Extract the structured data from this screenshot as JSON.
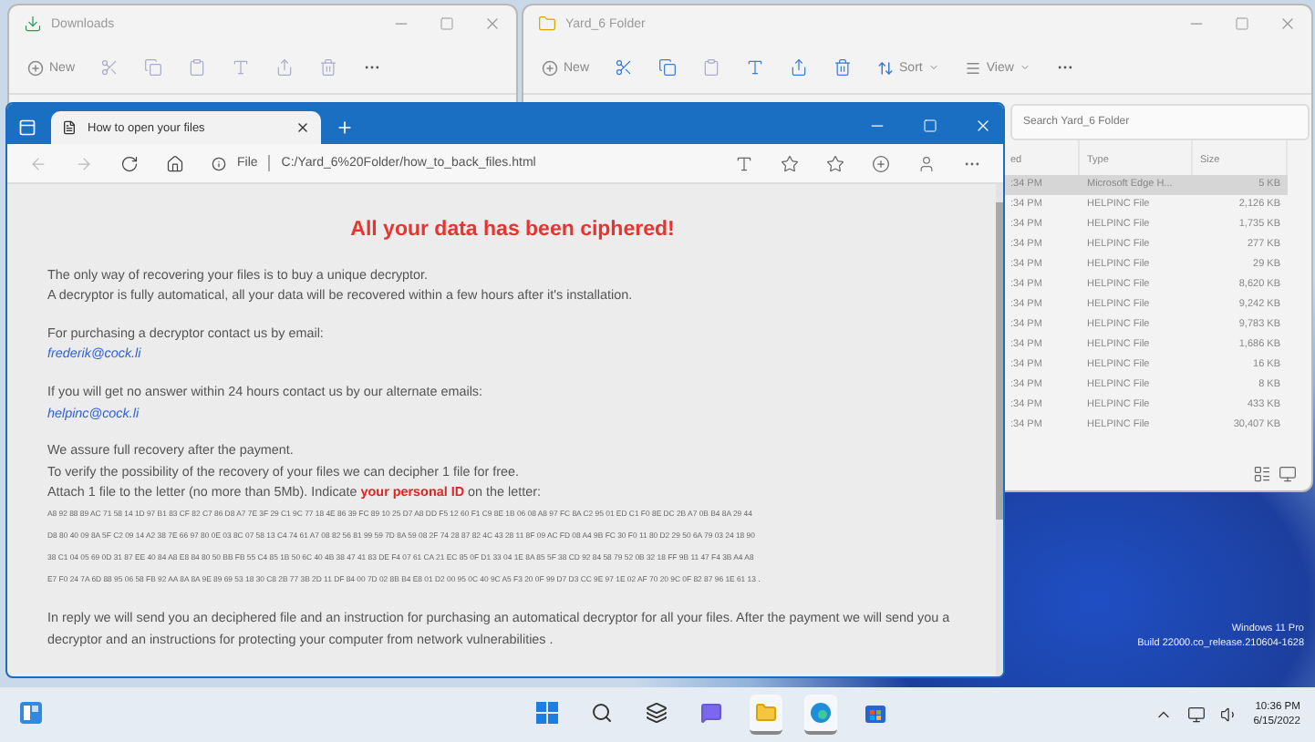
{
  "downloads_window": {
    "title": "Downloads",
    "new_button": "New"
  },
  "folder_window": {
    "title": "Yard_6 Folder",
    "new_button": "New",
    "sort_button": "Sort",
    "view_button": "View",
    "search": {
      "placeholder": "Search Yard_6 Folder"
    },
    "columns": [
      "ed",
      "Type",
      "Size"
    ],
    "rows": [
      {
        "date": ":34 PM",
        "type": "Microsoft Edge H...",
        "size": "5 KB",
        "selected": true
      },
      {
        "date": ":34 PM",
        "type": "HELPINC File",
        "size": "2,126 KB",
        "selected": false
      },
      {
        "date": ":34 PM",
        "type": "HELPINC File",
        "size": "1,735 KB",
        "selected": false
      },
      {
        "date": ":34 PM",
        "type": "HELPINC File",
        "size": "277 KB",
        "selected": false
      },
      {
        "date": ":34 PM",
        "type": "HELPINC File",
        "size": "29 KB",
        "selected": false
      },
      {
        "date": ":34 PM",
        "type": "HELPINC File",
        "size": "8,620 KB",
        "selected": false
      },
      {
        "date": ":34 PM",
        "type": "HELPINC File",
        "size": "9,242 KB",
        "selected": false
      },
      {
        "date": ":34 PM",
        "type": "HELPINC File",
        "size": "9,783 KB",
        "selected": false
      },
      {
        "date": ":34 PM",
        "type": "HELPINC File",
        "size": "1,686 KB",
        "selected": false
      },
      {
        "date": ":34 PM",
        "type": "HELPINC File",
        "size": "16 KB",
        "selected": false
      },
      {
        "date": ":34 PM",
        "type": "HELPINC File",
        "size": "8 KB",
        "selected": false
      },
      {
        "date": ":34 PM",
        "type": "HELPINC File",
        "size": "433 KB",
        "selected": false
      },
      {
        "date": ":34 PM",
        "type": "HELPINC File",
        "size": "30,407 KB",
        "selected": false
      }
    ]
  },
  "browser": {
    "tab_title": "How to open your files",
    "address_label": "File",
    "address": "C:/Yard_6%20Folder/how_to_back_files.html",
    "heading": "All your data has been ciphered!",
    "blocks": [
      [
        {
          "kind": "text",
          "text": "The only way of recovering your files is to buy a unique decryptor."
        },
        {
          "kind": "text",
          "text": "A decryptor is fully automatical, all your data will be recovered within a few hours after it's installation."
        }
      ],
      [
        {
          "kind": "text",
          "text": "For purchasing a decryptor contact us by email:"
        },
        {
          "kind": "link",
          "text": "frederik@cock.li"
        }
      ],
      [
        {
          "kind": "text",
          "text": "If you will get no answer within 24 hours contact us by our alternate emails:"
        },
        {
          "kind": "link",
          "text": "helpinc@cock.li"
        }
      ],
      [
        {
          "kind": "text",
          "text": "We assure full recovery after the payment."
        },
        {
          "kind": "text",
          "text": "To verify the possibility of the recovery of your files we can decipher 1 file for free."
        },
        {
          "kind": "text",
          "text": "Attach 1 file to the letter (no more than 5Mb). Indicate **your personal ID** on the letter:"
        },
        {
          "kind": "id",
          "text": "A8 92 88 89 AC 71 58 14 1D 97 B1 83 CF 82 C7 86 D8 A7 7E 3F 29 C1 9C 77 18 4E 86 39 FC 89 10 25 D7 A8 DD F5 12 60 F1 C9 8E 1B 06 08 A8 97 FC 8A C2 95 01 ED C1 F0 8E DC 2B A7 0B B4 8A 29 44"
        },
        {
          "kind": "id",
          "text": "D8 80 40 09 8A 5F C2 09 14 A2 38 7E 66 97 80 0E 03 8C 07 58 13 C4 74 61 A7 08 82 56 81 99 59 7D 8A 59 08 2F 74 28 87 82 4C 43 28 11 8F 09 AC FD 08 A4 9B FC 30 F0 11 80 D2 29 50 6A 79 03 24 18 90"
        },
        {
          "kind": "id",
          "text": "38 C1 04 05 69 0D 31 87 EE 40 84 A8 E8 84 80 50 BB FB 55 C4 85 1B 50 6C 40 4B 38 47 41 83 DE F4 07 61 CA 21 EC 85 0F D1 33 04 1E 8A 85 5F 38 CD 92 84 58 79 52 0B 32 18 FF 9B 11 47 F4 3B A4 A8"
        },
        {
          "kind": "id",
          "text": "E7 F0 24 7A 6D 88 95 06 58 FB 92 AA 8A 8A 9E 89 69 53 18 30 C8 2B 77 3B 2D 11 DF 84 00 7D 02 8B B4 E8 01 D2 00 95 0C 40 9C A5 F3 20 0F 99 D7 D3 CC 9E 97 1E 02 AF 70 20 9C 0F 82 87 96 1E 61 13 ."
        }
      ],
      [
        {
          "kind": "text",
          "text": "In reply we will send you an deciphered file and an instruction for purchasing an automatical decryptor for all your files. After the payment we will send you a decryptor and an instructions for protecting your computer from network vulnerabilities ."
        }
      ]
    ]
  },
  "desktop": {
    "edition": "Windows 11 Pro",
    "build": "Build 22000.co_release.210604-1628"
  },
  "taskbar": {
    "apps": [
      {
        "kind": "start",
        "running": false
      },
      {
        "kind": "search",
        "running": false
      },
      {
        "kind": "taskview",
        "running": false
      },
      {
        "kind": "chat",
        "running": false
      },
      {
        "kind": "explorer",
        "running": true
      },
      {
        "kind": "edge",
        "running": true
      },
      {
        "kind": "store",
        "running": false
      }
    ],
    "time": "10:36 PM",
    "date": "6/15/2022"
  }
}
